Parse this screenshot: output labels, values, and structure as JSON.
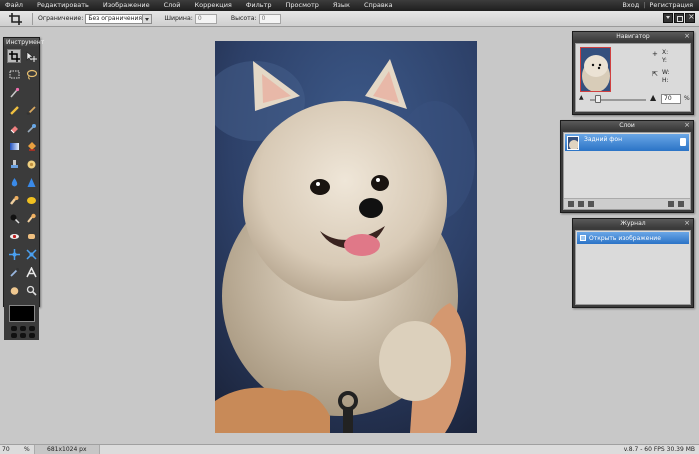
{
  "menubar": {
    "items": [
      "Файл",
      "Редактировать",
      "Изображение",
      "Слой",
      "Коррекция",
      "Фильтр",
      "Просмотр",
      "Язык",
      "Справка"
    ],
    "login": "Вход",
    "separator": "|",
    "register": "Регистрация"
  },
  "options": {
    "constraint_label": "Ограничение:",
    "constraint_value": "Без ограничения",
    "width_label": "Ширина:",
    "width_value": "0",
    "height_label": "Высота:",
    "height_value": "0"
  },
  "panels": {
    "tools_title": "Инструмент",
    "navigator_title": "Навигатор",
    "layers_title": "Слои",
    "history_title": "Журнал",
    "close_glyph": "×"
  },
  "navigator": {
    "x_label": "X:",
    "y_label": "Y:",
    "w_label": "W:",
    "h_label": "H:",
    "zoom": "70",
    "zoom_unit": "%",
    "zoom_slider_level": 0.15
  },
  "layers": {
    "items": [
      {
        "name": "Задний фон",
        "locked": true
      }
    ]
  },
  "history": {
    "items": [
      {
        "label": "Открыть изображение"
      }
    ]
  },
  "status": {
    "zoom": "70",
    "zoom_unit": "%",
    "image_size": "681x1024 px",
    "fps_memory": "v.8.7 - 60 FPS 30.39 MB"
  },
  "tools": [
    "crop-tool",
    "move-tool",
    "marquee-tool",
    "lasso-tool",
    "wand-tool",
    "",
    "pencil-tool",
    "brush-tool",
    "eraser-tool",
    "replace-color-tool",
    "gradient-tool",
    "fill-tool",
    "clone-stamp-tool",
    "color-picker-tool",
    "drop-tool",
    "sharpen-tool",
    "smudge-tool",
    "sponge-tool",
    "burn-tool",
    "dodge-tool",
    "red-eye-tool",
    "spot-heal-tool",
    "bloat-tool",
    "pinch-tool",
    "picker-tool",
    "text-tool",
    "hand-tool",
    "zoom-tool"
  ],
  "colors": {
    "menubar": "#2a2a2a",
    "accent_blue": "#2b73c6",
    "foreground": "#000000"
  }
}
